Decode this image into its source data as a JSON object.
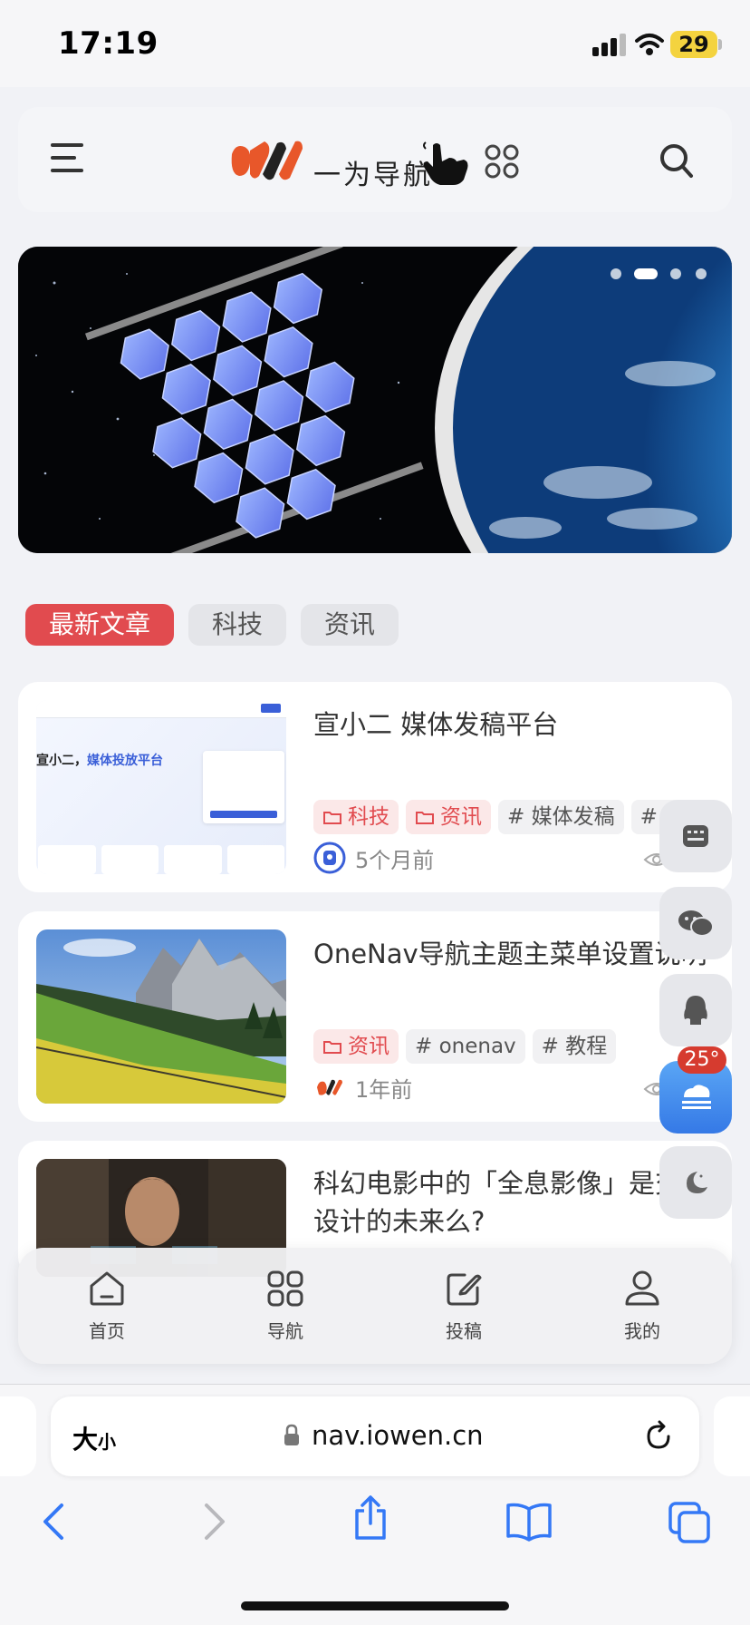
{
  "status_bar": {
    "time": "17:19",
    "battery": "29"
  },
  "header": {
    "brand_text": "一为导航"
  },
  "category_tabs": [
    {
      "label": "最新文章",
      "active": true
    },
    {
      "label": "科技",
      "active": false
    },
    {
      "label": "资讯",
      "active": false
    }
  ],
  "articles": [
    {
      "title": "宣小二 媒体发稿平台",
      "tags": [
        {
          "label": "科技",
          "kind": "category"
        },
        {
          "label": "资讯",
          "kind": "category"
        },
        {
          "label": "# 媒体发稿",
          "kind": "tag"
        },
        {
          "label": "# 新闻",
          "kind": "tag"
        }
      ],
      "time": "5个月前",
      "thumb_text": {
        "headline": "宣小二，",
        "headline_accent": "媒体投放平台"
      }
    },
    {
      "title": "OneNav导航主题主菜单设置说明",
      "tags": [
        {
          "label": "资讯",
          "kind": "category"
        },
        {
          "label": "# onenav",
          "kind": "tag"
        },
        {
          "label": "# 教程",
          "kind": "tag"
        }
      ],
      "time": "1年前"
    },
    {
      "title_line1": "科幻电影中的「全息影像」是交互",
      "title_line2": "设计的未来么?"
    }
  ],
  "weather": {
    "temp": "25°"
  },
  "bottom_nav": [
    {
      "label": "首页",
      "icon": "home-icon"
    },
    {
      "label": "导航",
      "icon": "grid-icon"
    },
    {
      "label": "投稿",
      "icon": "edit-icon"
    },
    {
      "label": "我的",
      "icon": "user-icon"
    }
  ],
  "safari": {
    "text_size_big": "大",
    "text_size_small": "小",
    "url": "nav.iowen.cn"
  },
  "colors": {
    "accent": "#e14b4f",
    "brand_orange": "#e8572a",
    "link_blue": "#3478f6"
  }
}
